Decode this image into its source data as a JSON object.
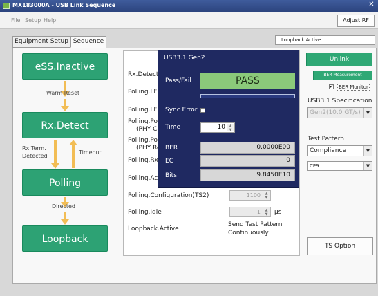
{
  "window": {
    "title": "MX183000A - USB Link Sequence",
    "close_glyph": "✕"
  },
  "menu": {
    "file": "File",
    "setup": "Setup",
    "help": "Help"
  },
  "toolbar": {
    "adjust_rf": "Adjust RF"
  },
  "tabs": {
    "equipment_setup": "Equipment Setup",
    "sequence": "Sequence"
  },
  "mode": "Loopback Active",
  "states": {
    "ess_inactive": "eSS.Inactive",
    "rx_detect": "Rx.Detect",
    "polling": "Polling",
    "loopback": "Loopback"
  },
  "transitions": {
    "warm_reset": "Warm Reset",
    "rx_term_detected_1": "Rx Term.",
    "rx_term_detected_2": "Detected",
    "timeout": "Timeout",
    "directed": "Directed"
  },
  "conditions": {
    "rx_detect_active": "Rx.Detect.Active",
    "polling_lfps": "Polling.LFPS",
    "polling_lfps2": "Polling.LFPS",
    "polling_port_1a": "Polling.PortMatch",
    "polling_port_1b": "(PHY Capability)",
    "polling_port_2a": "Polling.PortConfig",
    "polling_port_2b": "(PHY Ready)",
    "polling_rxeq": "Polling.RxEQ",
    "polling_active": "Polling.Active",
    "polling_config": "Polling.Configuration(TS2)",
    "polling_config_value": "1100",
    "polling_idle": "Polling.Idle",
    "polling_idle_value": "1",
    "polling_idle_unit": "μs",
    "loopback_active": "Loopback.Active",
    "send_pattern_1": "Send Test Pattern",
    "send_pattern_2": "Continuously"
  },
  "popup": {
    "title": "USB3.1 Gen2",
    "pass_fail_label": "Pass/Fail",
    "pass_fail_value": "PASS",
    "sync_error_label": "Sync Error",
    "time_label": "Time",
    "time_value": "10",
    "ber_label": "BER",
    "ber_value": "0.0000E00",
    "ec_label": "EC",
    "ec_value": "0",
    "bits_label": "Bits",
    "bits_value": "9.8450E10"
  },
  "right": {
    "unlink": "Unlink",
    "ber_measurement": "BER Measurement",
    "ber_monitor": "BER Monitor",
    "ber_monitor_checked": "✔",
    "spec_label": "USB3.1 Specification",
    "spec_value": "Gen2(10.0 GT/s)",
    "pattern_label": "Test Pattern",
    "pattern_value": "Compliance",
    "cp_value": "CP9",
    "ts_option": "TS Option"
  },
  "colors": {
    "state_green": "#2da274",
    "arrow_orange": "#f2bd55",
    "popup_navy": "#1f2961",
    "pass_green": "#8bc97a",
    "title_blue": "#3f5c9c"
  }
}
